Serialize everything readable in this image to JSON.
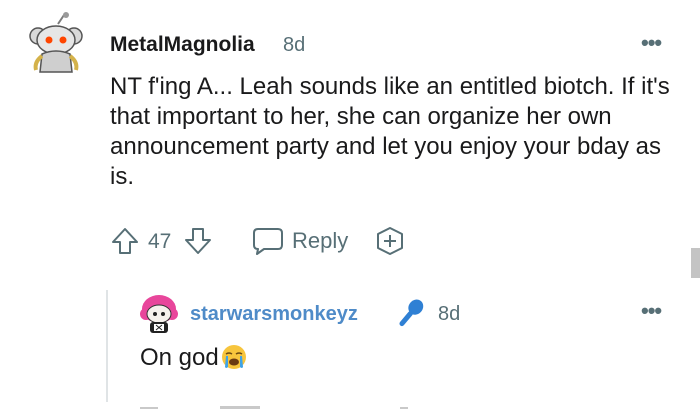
{
  "comment": {
    "username": "MetalMagnolia",
    "time": "8d",
    "more": "•••",
    "body": "NT f'ing A... Leah sounds like an entitled biotch. If it's that important to her, she can organize her own announcement party and let you enjoy your bday as is.",
    "score": "47",
    "reply_label": "Reply"
  },
  "reply": {
    "username": "starwarsmonkeyz",
    "time": "8d",
    "more": "•••",
    "body": "On god"
  },
  "colors": {
    "username_reply": "#4f8bc8",
    "meta": "#576f76",
    "text": "#1a1a1b",
    "mic": "#2f80d4"
  },
  "icons": [
    "reddit-snoo-avatar",
    "upvote-icon",
    "downvote-icon",
    "speech-bubble-icon",
    "plus-circle-icon",
    "microphone-icon",
    "crying-face-emoji",
    "more-options-icon"
  ]
}
